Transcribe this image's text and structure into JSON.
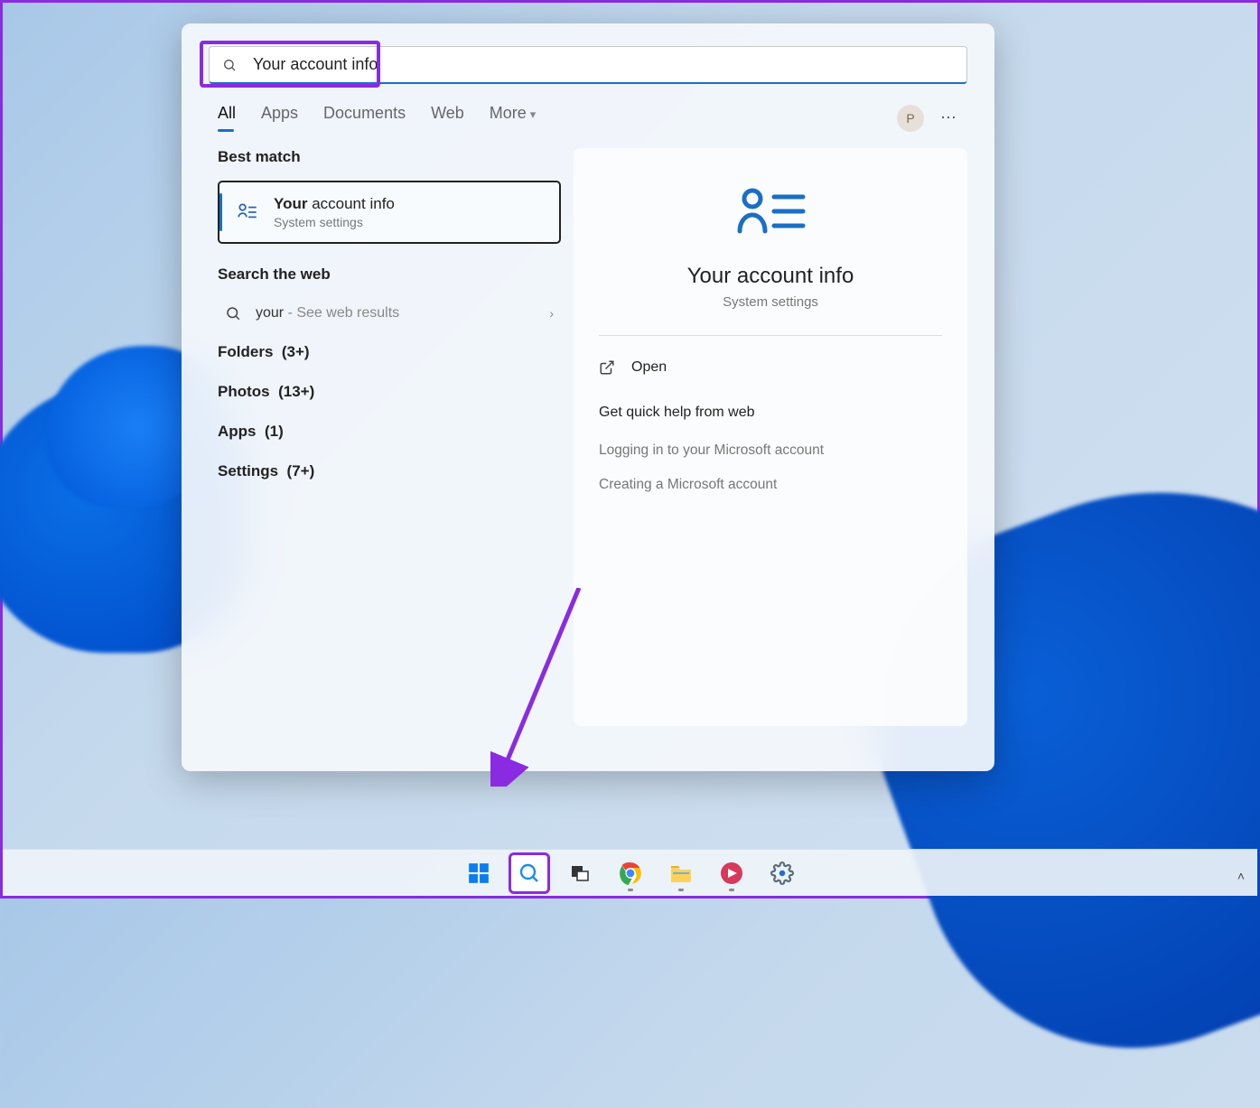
{
  "search": {
    "query": "Your account info"
  },
  "tabs": {
    "all": "All",
    "apps": "Apps",
    "documents": "Documents",
    "web": "Web",
    "more": "More"
  },
  "user_initial": "P",
  "left": {
    "best_match_header": "Best match",
    "best_match": {
      "title_bold": "Your",
      "title_rest": " account info",
      "subtitle": "System settings"
    },
    "search_web_header": "Search the web",
    "web_item": {
      "term": "your",
      "suffix": " - See web results"
    },
    "cats": {
      "folders_label": "Folders",
      "folders_count": "(3+)",
      "photos_label": "Photos",
      "photos_count": "(13+)",
      "apps_label": "Apps",
      "apps_count": "(1)",
      "settings_label": "Settings",
      "settings_count": "(7+)"
    }
  },
  "right": {
    "title": "Your account info",
    "subtitle": "System settings",
    "open_label": "Open",
    "help_header": "Get quick help from web",
    "help1": "Logging in to your Microsoft account",
    "help2": "Creating a Microsoft account"
  },
  "taskbar": {
    "items": [
      "start",
      "search",
      "taskview",
      "chrome",
      "explorer",
      "record",
      "settings"
    ]
  }
}
